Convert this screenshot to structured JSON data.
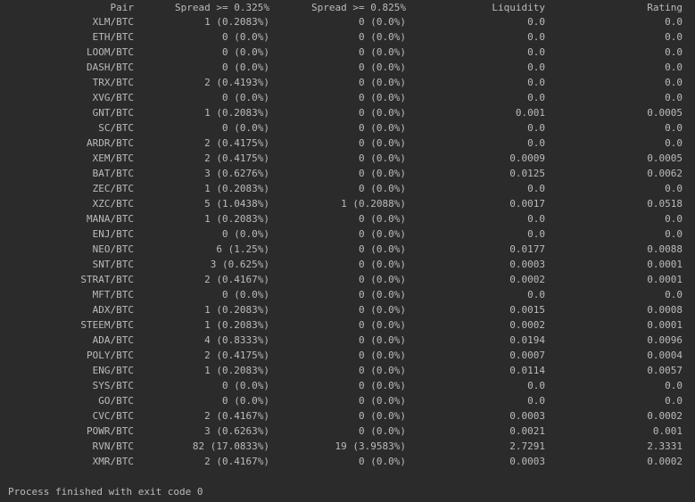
{
  "headers": {
    "pair": "Pair",
    "spread1": "Spread >= 0.325%",
    "spread2": "Spread >= 0.825%",
    "liquidity": "Liquidity",
    "rating": "Rating"
  },
  "rows": [
    {
      "pair": "XLM/BTC",
      "spread1": "1 (0.2083%)",
      "spread2": "0 (0.0%)",
      "liquidity": "0.0",
      "rating": "0.0"
    },
    {
      "pair": "ETH/BTC",
      "spread1": "0 (0.0%)",
      "spread2": "0 (0.0%)",
      "liquidity": "0.0",
      "rating": "0.0"
    },
    {
      "pair": "LOOM/BTC",
      "spread1": "0 (0.0%)",
      "spread2": "0 (0.0%)",
      "liquidity": "0.0",
      "rating": "0.0"
    },
    {
      "pair": "DASH/BTC",
      "spread1": "0 (0.0%)",
      "spread2": "0 (0.0%)",
      "liquidity": "0.0",
      "rating": "0.0"
    },
    {
      "pair": "TRX/BTC",
      "spread1": "2 (0.4193%)",
      "spread2": "0 (0.0%)",
      "liquidity": "0.0",
      "rating": "0.0"
    },
    {
      "pair": "XVG/BTC",
      "spread1": "0 (0.0%)",
      "spread2": "0 (0.0%)",
      "liquidity": "0.0",
      "rating": "0.0"
    },
    {
      "pair": "GNT/BTC",
      "spread1": "1 (0.2083%)",
      "spread2": "0 (0.0%)",
      "liquidity": "0.001",
      "rating": "0.0005"
    },
    {
      "pair": "SC/BTC",
      "spread1": "0 (0.0%)",
      "spread2": "0 (0.0%)",
      "liquidity": "0.0",
      "rating": "0.0"
    },
    {
      "pair": "ARDR/BTC",
      "spread1": "2 (0.4175%)",
      "spread2": "0 (0.0%)",
      "liquidity": "0.0",
      "rating": "0.0"
    },
    {
      "pair": "XEM/BTC",
      "spread1": "2 (0.4175%)",
      "spread2": "0 (0.0%)",
      "liquidity": "0.0009",
      "rating": "0.0005"
    },
    {
      "pair": "BAT/BTC",
      "spread1": "3 (0.6276%)",
      "spread2": "0 (0.0%)",
      "liquidity": "0.0125",
      "rating": "0.0062"
    },
    {
      "pair": "ZEC/BTC",
      "spread1": "1 (0.2083%)",
      "spread2": "0 (0.0%)",
      "liquidity": "0.0",
      "rating": "0.0"
    },
    {
      "pair": "XZC/BTC",
      "spread1": "5 (1.0438%)",
      "spread2": "1 (0.2088%)",
      "liquidity": "0.0017",
      "rating": "0.0518"
    },
    {
      "pair": "MANA/BTC",
      "spread1": "1 (0.2083%)",
      "spread2": "0 (0.0%)",
      "liquidity": "0.0",
      "rating": "0.0"
    },
    {
      "pair": "ENJ/BTC",
      "spread1": "0 (0.0%)",
      "spread2": "0 (0.0%)",
      "liquidity": "0.0",
      "rating": "0.0"
    },
    {
      "pair": "NEO/BTC",
      "spread1": "6 (1.25%)",
      "spread2": "0 (0.0%)",
      "liquidity": "0.0177",
      "rating": "0.0088"
    },
    {
      "pair": "SNT/BTC",
      "spread1": "3 (0.625%)",
      "spread2": "0 (0.0%)",
      "liquidity": "0.0003",
      "rating": "0.0001"
    },
    {
      "pair": "STRAT/BTC",
      "spread1": "2 (0.4167%)",
      "spread2": "0 (0.0%)",
      "liquidity": "0.0002",
      "rating": "0.0001"
    },
    {
      "pair": "MFT/BTC",
      "spread1": "0 (0.0%)",
      "spread2": "0 (0.0%)",
      "liquidity": "0.0",
      "rating": "0.0"
    },
    {
      "pair": "ADX/BTC",
      "spread1": "1 (0.2083%)",
      "spread2": "0 (0.0%)",
      "liquidity": "0.0015",
      "rating": "0.0008"
    },
    {
      "pair": "STEEM/BTC",
      "spread1": "1 (0.2083%)",
      "spread2": "0 (0.0%)",
      "liquidity": "0.0002",
      "rating": "0.0001"
    },
    {
      "pair": "ADA/BTC",
      "spread1": "4 (0.8333%)",
      "spread2": "0 (0.0%)",
      "liquidity": "0.0194",
      "rating": "0.0096"
    },
    {
      "pair": "POLY/BTC",
      "spread1": "2 (0.4175%)",
      "spread2": "0 (0.0%)",
      "liquidity": "0.0007",
      "rating": "0.0004"
    },
    {
      "pair": "ENG/BTC",
      "spread1": "1 (0.2083%)",
      "spread2": "0 (0.0%)",
      "liquidity": "0.0114",
      "rating": "0.0057"
    },
    {
      "pair": "SYS/BTC",
      "spread1": "0 (0.0%)",
      "spread2": "0 (0.0%)",
      "liquidity": "0.0",
      "rating": "0.0"
    },
    {
      "pair": "GO/BTC",
      "spread1": "0 (0.0%)",
      "spread2": "0 (0.0%)",
      "liquidity": "0.0",
      "rating": "0.0"
    },
    {
      "pair": "CVC/BTC",
      "spread1": "2 (0.4167%)",
      "spread2": "0 (0.0%)",
      "liquidity": "0.0003",
      "rating": "0.0002"
    },
    {
      "pair": "POWR/BTC",
      "spread1": "3 (0.6263%)",
      "spread2": "0 (0.0%)",
      "liquidity": "0.0021",
      "rating": "0.001"
    },
    {
      "pair": "RVN/BTC",
      "spread1": "82 (17.0833%)",
      "spread2": "19 (3.9583%)",
      "liquidity": "2.7291",
      "rating": "2.3331"
    },
    {
      "pair": "XMR/BTC",
      "spread1": "2 (0.4167%)",
      "spread2": "0 (0.0%)",
      "liquidity": "0.0003",
      "rating": "0.0002"
    }
  ],
  "exit_message": "Process finished with exit code 0",
  "colors": {
    "background": "#2b2b2b",
    "text": "#bbbbbb"
  }
}
